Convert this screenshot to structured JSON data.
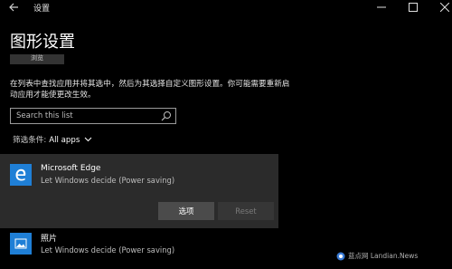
{
  "window": {
    "title": "设置",
    "back_icon": "back-arrow-icon",
    "controls": [
      "minimize-icon",
      "maximize-icon",
      "close-icon"
    ]
  },
  "page": {
    "title": "图形设置",
    "browse_label": "浏览",
    "description": "在列表中查找应用并将其选中，然后为其选择自定义图形设置。你可能需要重新启动应用才能使更改生效。"
  },
  "search": {
    "placeholder": "Search this list",
    "icon": "search-icon"
  },
  "filter": {
    "label": "筛选条件:",
    "value": "All apps"
  },
  "apps": [
    {
      "name": "Microsoft Edge",
      "setting": "Let Windows decide (Power saving)",
      "icon": "edge-icon",
      "expanded": true,
      "options_label": "选项",
      "reset_label": "Reset",
      "reset_enabled": false
    },
    {
      "name": "照片",
      "setting": "Let Windows decide (Power saving)",
      "icon": "photos-icon"
    }
  ],
  "watermark": {
    "text": "蓝点网 Landian.News"
  },
  "colors": {
    "background": "#000000",
    "card": "#2b2b2b",
    "accent": "#1f7fd6",
    "button": "#4b4b4b"
  }
}
